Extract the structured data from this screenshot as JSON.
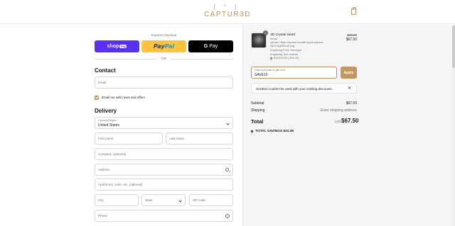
{
  "brand": {
    "logo_mark": "[ ' ]",
    "logo_text": "CAPTUR3D",
    "accent": "#c1965f"
  },
  "express": {
    "title": "Express checkout",
    "shop_label": "shop",
    "shop_chip": "Pay",
    "paypal_a": "Pay",
    "paypal_b": "Pal",
    "gpay_g": "G",
    "gpay_label": "Pay",
    "or_text": "OR"
  },
  "contact": {
    "heading": "Contact",
    "email_placeholder": "Email",
    "newsletter_label": "Email me with news and offers",
    "newsletter_checked": true
  },
  "delivery": {
    "heading": "Delivery",
    "country_label": "Country/Region",
    "country_value": "United States",
    "first_name": "First name",
    "last_name": "Last name",
    "company": "Company (optional)",
    "address": "Address",
    "apartment": "Apartment, suite, etc. (optional)",
    "city": "City",
    "state": "State",
    "zip": "ZIP code",
    "phone": "Phone"
  },
  "order": {
    "item": {
      "qty": "1",
      "name": "3D Crystal Heart",
      "size": "Small",
      "upload_line1": "upload: https://upload.cloudlift.app/s/capture-",
      "upload_line2": "3d/f7c4g2f9vn4l.png",
      "engraving_font": "Engraving Font: monotype",
      "engraving_text": "Engraving Text: wdewd",
      "discount_line": "EN00/2025 (-$22.49)",
      "original_price": "$89.99",
      "price": "$67.50"
    },
    "discount": {
      "label": "Discount code or gift card",
      "value": "SAVE10",
      "apply_label": "Apply"
    },
    "alert": {
      "text": "SAVE10 couldn't be used with your existing discounts.",
      "close": "✕"
    },
    "summary": {
      "subtotal_label": "Subtotal",
      "subtotal_value": "$67.50",
      "shipping_label": "Shipping",
      "shipping_value": "Enter shipping address",
      "total_label": "Total",
      "currency": "USD",
      "total_value": "$67.50",
      "savings": "TOTAL SAVINGS $22.49"
    }
  }
}
